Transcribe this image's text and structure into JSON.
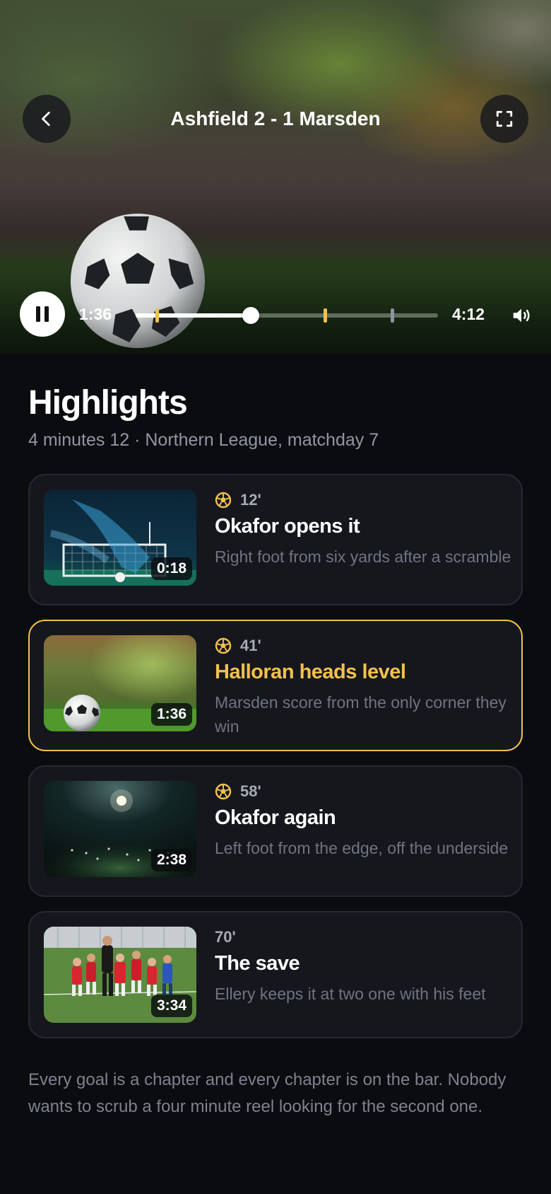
{
  "player": {
    "title": "Ashfield 2 - 1 Marsden",
    "current_time": "1:36",
    "total_time": "4:12",
    "progress_fraction": 0.381,
    "chapter_markers": [
      {
        "fraction": 0.071,
        "color": "#f2c14e"
      },
      {
        "fraction": 0.627,
        "color": "#f2c14e"
      },
      {
        "fraction": 0.849,
        "color": "#8d93a0"
      }
    ],
    "state": "playing",
    "icons": {
      "back": "chevron-left-icon",
      "fullscreen": "fullscreen-icon",
      "pause": "pause-icon",
      "volume": "volume-icon"
    }
  },
  "highlights": {
    "title": "Highlights",
    "subtitle": "4 minutes 12 · Northern League, matchday 7",
    "items": [
      {
        "minute": "12'",
        "title": "Okafor opens it",
        "description": "Right foot from six yards after a scramble",
        "duration": "0:18",
        "goal": true,
        "active": false
      },
      {
        "minute": "41'",
        "title": "Halloran heads level",
        "description": "Marsden score from the only corner they win",
        "duration": "1:36",
        "goal": true,
        "active": true
      },
      {
        "minute": "58'",
        "title": "Okafor again",
        "description": "Left foot from the edge, off the underside",
        "duration": "2:38",
        "goal": true,
        "active": false
      },
      {
        "minute": "70'",
        "title": "The save",
        "description": "Ellery keeps it at two one with his feet",
        "duration": "3:34",
        "goal": false,
        "active": false
      }
    ]
  },
  "footer": {
    "text": "Every goal is a chapter and every chapter is on the bar. Nobody wants to scrub a four minute reel looking for the second one."
  },
  "colors": {
    "accent": "#f2c14e",
    "background": "#0b0c10",
    "card": "#15171d",
    "muted_text": "#6f7480"
  }
}
